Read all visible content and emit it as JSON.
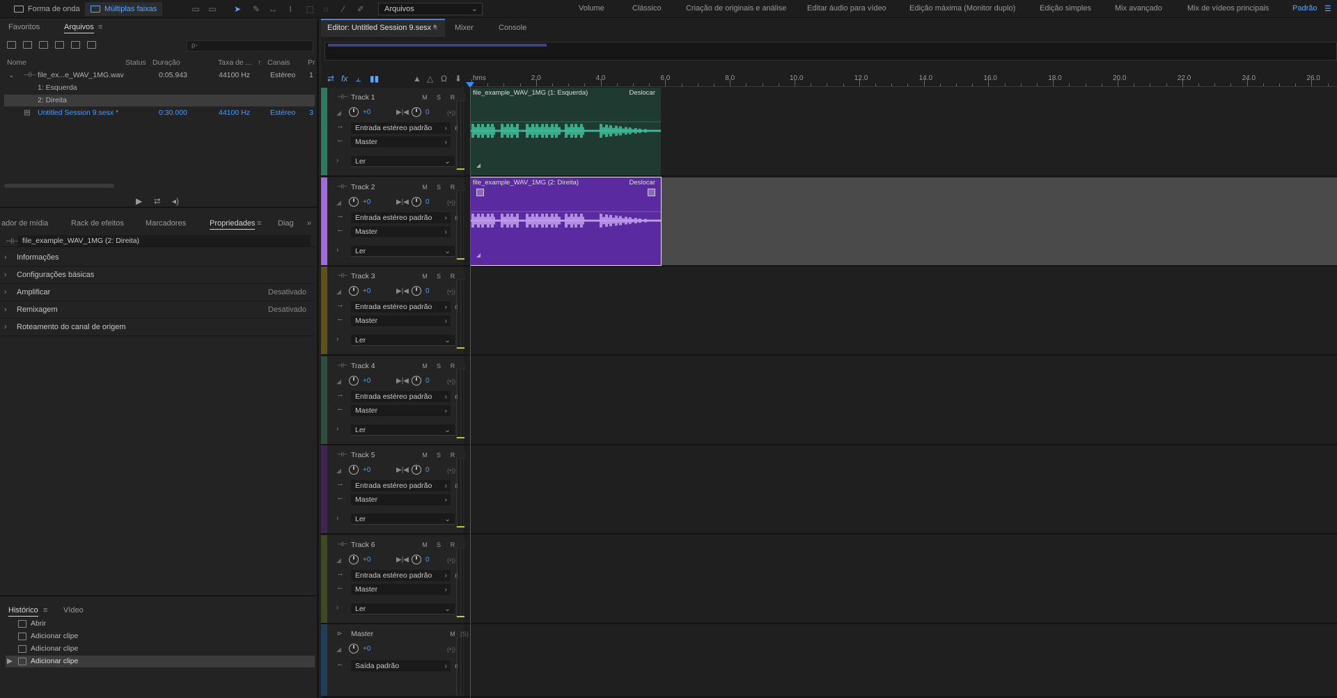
{
  "topbar": {
    "mode_waveform": "Forma de onda",
    "mode_multitrack": "Múltiplas faixas",
    "file_select": "Arquivos",
    "workspaces": [
      "Volume",
      "Clássico",
      "Criação de originais e análise",
      "Editar áudio para vídeo",
      "Edição máxima (Monitor duplo)",
      "Edição simples",
      "Mix avançado",
      "Mix de vídeos principais",
      "Padrão"
    ],
    "active_workspace": "Padrão"
  },
  "files_panel": {
    "tabs": [
      "Favoritos",
      "Arquivos"
    ],
    "active_tab": "Arquivos",
    "search_placeholder": "ρ-",
    "columns": [
      "Nome",
      "Status",
      "Duração",
      "Taxa de ...",
      "Canais",
      "Pr"
    ],
    "rows": [
      {
        "name": "file_ex...e_WAV_1MG.wav",
        "status": "",
        "duration": "0:05.943",
        "rate": "44100 Hz",
        "channels": "Estéreo",
        "extra": "1"
      },
      {
        "name": "1: Esquerda"
      },
      {
        "name": "2: Direita"
      },
      {
        "name": "Untitled Session 9.sesx *",
        "status": "",
        "duration": "0:30.000",
        "rate": "44100 Hz",
        "channels": "Estéreo",
        "extra": "3"
      }
    ]
  },
  "props_panel": {
    "tabs": [
      "ador de mídia",
      "Rack de efeitos",
      "Marcadores",
      "Propriedades",
      "Diag"
    ],
    "active_tab": "Propriedades",
    "title": "file_example_WAV_1MG (2: Direita)",
    "sections": [
      {
        "label": "Informações",
        "state": ""
      },
      {
        "label": "Configurações básicas",
        "state": ""
      },
      {
        "label": "Amplificar",
        "state": "Desativado"
      },
      {
        "label": "Remixagem",
        "state": "Desativado"
      },
      {
        "label": "Roteamento do canal de origem",
        "state": ""
      }
    ]
  },
  "history_panel": {
    "tabs": [
      "Histórico",
      "Vídeo"
    ],
    "active_tab": "Histórico",
    "items": [
      "Abrir",
      "Adicionar clipe",
      "Adicionar clipe",
      "Adicionar clipe"
    ]
  },
  "editor": {
    "tabs": [
      "Editor: Untitled Session 9.sesx *",
      "Mixer",
      "Console"
    ],
    "ruler": {
      "unit": "hms",
      "labels": [
        "2.0",
        "4.0",
        "6.0",
        "8.0",
        "10.0",
        "12.0",
        "14.0",
        "16.0",
        "18.0",
        "20.0",
        "22.0",
        "24.0",
        "26.0"
      ]
    },
    "track_controls": {
      "mute": "M",
      "solo": "S",
      "record": "R",
      "volume": "+0",
      "pan": "0",
      "input": "Entrada estéreo padrão",
      "output": "Master",
      "automation": "Ler"
    },
    "tracks": [
      {
        "name": "Track 1",
        "color": "#2d7a63",
        "clip": {
          "title": "file_example_WAV_1MG (1: Esquerda)",
          "mode": "Deslocar",
          "bg": "#1f3a31",
          "wave": "#3fc9a2"
        }
      },
      {
        "name": "Track 2",
        "color": "#a36bde",
        "clip": {
          "title": "file_example_WAV_1MG (2: Direita)",
          "mode": "Deslocar",
          "bg": "#5a2aa0",
          "wave": "#c9a8f3"
        }
      },
      {
        "name": "Track 3",
        "color": "#5c5316"
      },
      {
        "name": "Track 4",
        "color": "#2a4f3e"
      },
      {
        "name": "Track 5",
        "color": "#3f2355"
      },
      {
        "name": "Track 6",
        "color": "#3d4a1e"
      }
    ],
    "master": {
      "name": "Master",
      "mute": "M",
      "volume": "+0",
      "output": "Saída padrão",
      "color": "#1f3d5c"
    }
  }
}
